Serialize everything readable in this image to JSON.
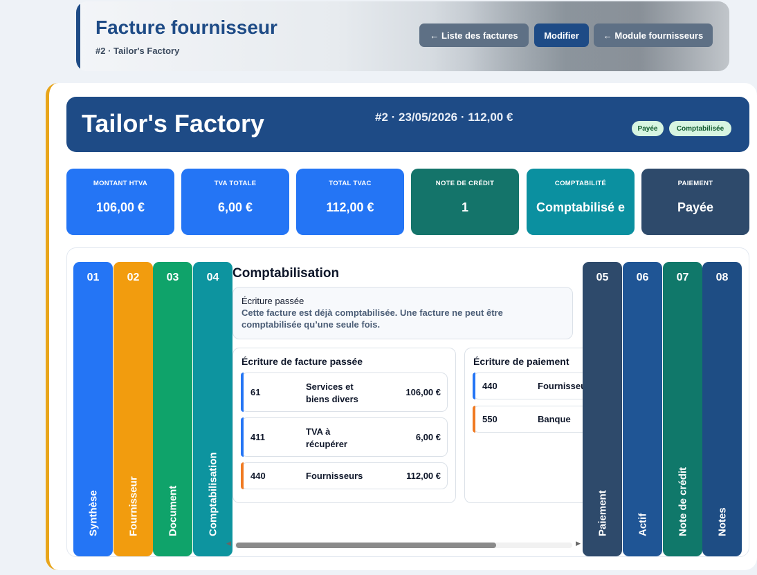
{
  "header": {
    "title": "Facture fournisseur",
    "subtitle": "#2 · Tailor's Factory",
    "buttons": {
      "invoices": "← Liste des factures",
      "edit": "Modifier",
      "suppliers": "← Module fournisseurs"
    }
  },
  "banner": {
    "name": "Tailor's Factory",
    "meta": "#2 · 23/05/2026 · 112,00 €",
    "badges": [
      "Payée",
      "Comptabilisée"
    ]
  },
  "kpis": [
    {
      "label": "MONTANT HTVA",
      "value": "106,00 €",
      "color": "#2475f5"
    },
    {
      "label": "TVA TOTALE",
      "value": "6,00 €",
      "color": "#2475f5"
    },
    {
      "label": "TOTAL TVAC",
      "value": "112,00 €",
      "color": "#2475f5"
    },
    {
      "label": "NOTE DE CRÉDIT",
      "value": "1",
      "color": "#14746a"
    },
    {
      "label": "COMPTABILITÉ",
      "value": "Comptabilisé e",
      "color": "#0b90a0"
    },
    {
      "label": "PAIEMENT",
      "value": "Payée",
      "color": "#2e4a6b"
    }
  ],
  "tabs": [
    {
      "num": "01",
      "label": "Synthèse",
      "color": "#2475f5"
    },
    {
      "num": "02",
      "label": "Fournisseur",
      "color": "#f29c0e"
    },
    {
      "num": "03",
      "label": "Document",
      "color": "#0fa36a"
    },
    {
      "num": "04",
      "label": "Comptabilisation",
      "color": "#0d949f"
    },
    {
      "num": "05",
      "label": "Paiement",
      "color": "#2e4a6b"
    },
    {
      "num": "06",
      "label": "Actif",
      "color": "#1f5595"
    },
    {
      "num": "07",
      "label": "Note de crédit",
      "color": "#10786a"
    },
    {
      "num": "08",
      "label": "Notes",
      "color": "#1e4d84"
    }
  ],
  "content": {
    "title": "Comptabilisation",
    "notice_heading": "Écriture passée",
    "notice_text": "Cette facture est déjà comptabilisée. Une facture ne peut être comptabilisée qu’une seule fois.",
    "invoice_box": {
      "heading": "Écriture de facture passée",
      "lines": [
        {
          "account": "61",
          "label": "Services et biens divers",
          "amount": "106,00 €",
          "accent": "#2475f5"
        },
        {
          "account": "411",
          "label": "TVA à récupérer",
          "amount": "6,00 €",
          "accent": "#2475f5"
        },
        {
          "account": "440",
          "label": "Fournisseurs",
          "amount": "112,00 €",
          "accent": "#f07a22"
        }
      ]
    },
    "payment_box": {
      "heading": "Écriture de paiement",
      "lines": [
        {
          "account": "440",
          "label": "Fournisseurs",
          "accent": "#2475f5"
        },
        {
          "account": "550",
          "label": "Banque",
          "accent": "#f07a22"
        }
      ]
    }
  }
}
